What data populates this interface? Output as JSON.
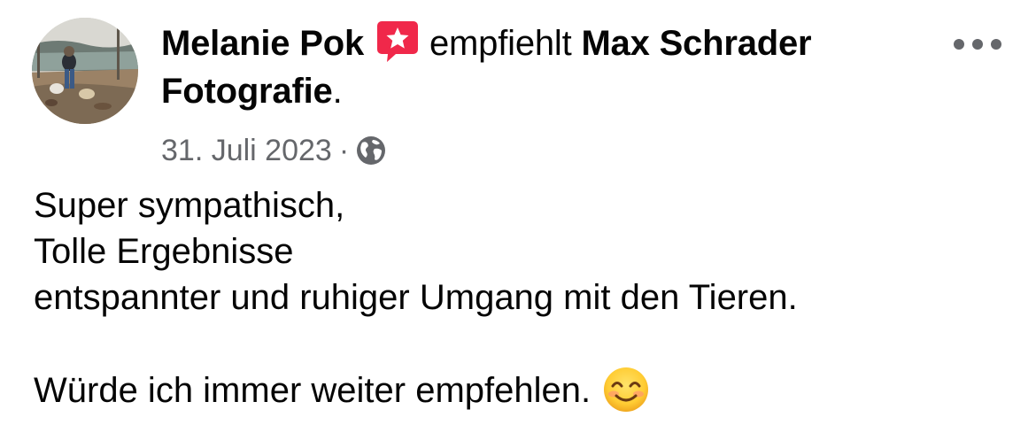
{
  "post": {
    "author": "Melanie Pok",
    "verb": "empfiehlt",
    "page_name": "Max Schrader Fotografie",
    "period": ".",
    "date": "31. Juli 2023",
    "separator": "·",
    "privacy_icon": "globe-icon",
    "recommend_icon": "recommendation-star-icon",
    "more_icon": "more-options-icon",
    "body_lines": [
      "Super sympathisch,",
      "Tolle Ergebnisse",
      "entspannter und ruhiger Umgang mit den Tieren.",
      "",
      "Würde ich immer weiter empfehlen."
    ],
    "emoji": "smiling-face-emoji",
    "colors": {
      "recommend_badge": "#f0284a",
      "meta_text": "#65676b",
      "text": "#050505"
    }
  }
}
